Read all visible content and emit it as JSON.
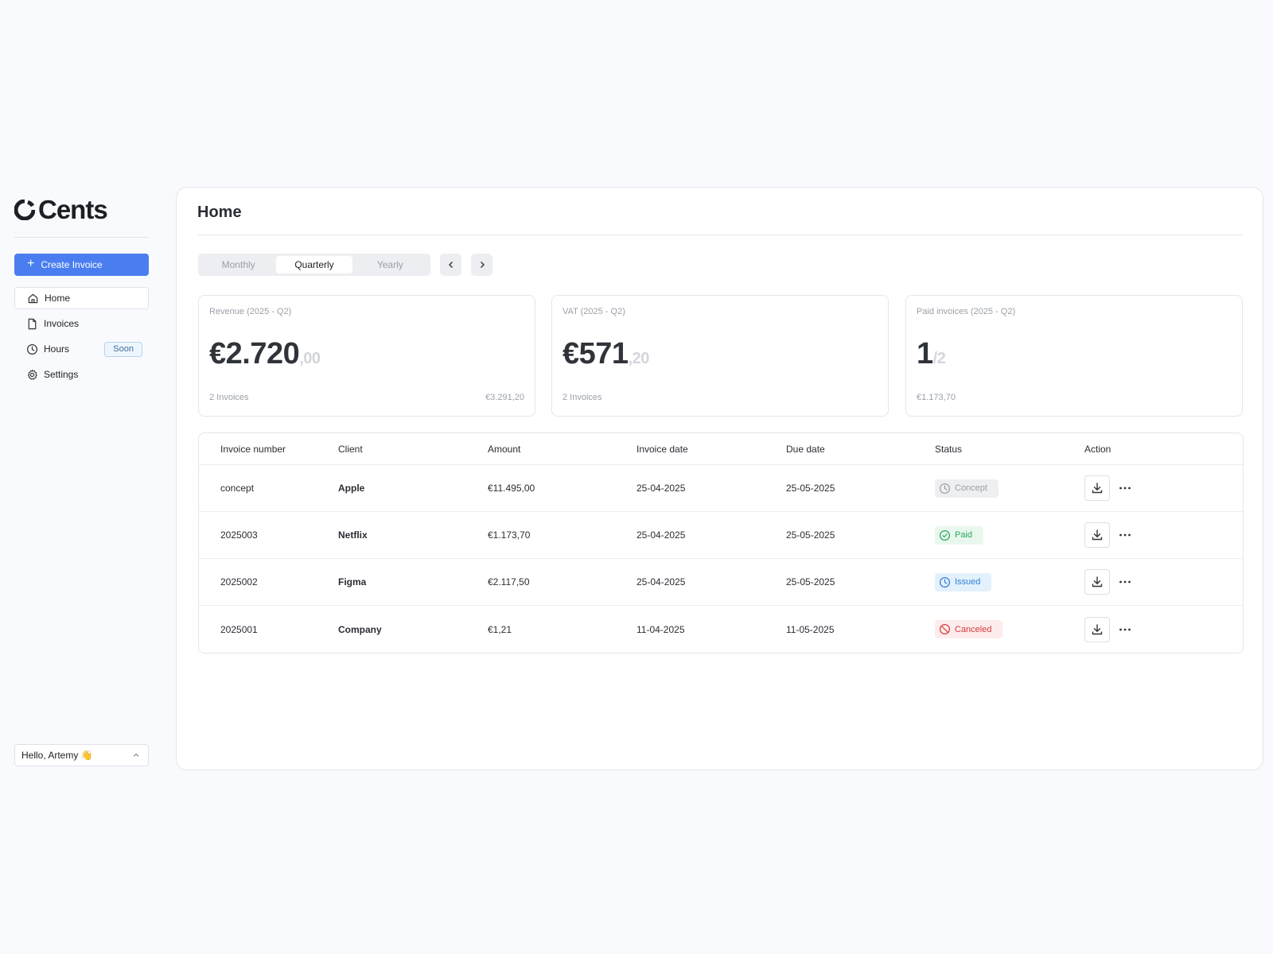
{
  "brand": {
    "name": "Cents"
  },
  "sidebar": {
    "create_label": "Create Invoice",
    "items": [
      {
        "label": "Home",
        "icon": "home-icon"
      },
      {
        "label": "Invoices",
        "icon": "file-icon"
      },
      {
        "label": "Hours",
        "icon": "clock-icon",
        "badge": "Soon"
      },
      {
        "label": "Settings",
        "icon": "gear-icon"
      }
    ],
    "user_greeting": "Hello, Artemy 👋"
  },
  "main": {
    "title": "Home",
    "period_tabs": [
      "Monthly",
      "Quarterly",
      "Yearly"
    ],
    "active_period": "Quarterly",
    "cards": [
      {
        "label": "Revenue (2025 - Q2)",
        "value": "€2.720",
        "decimals": ",00",
        "foot_left": "2 Invoices",
        "foot_right": "€3.291,20"
      },
      {
        "label": "VAT (2025 - Q2)",
        "value": "€571",
        "decimals": ",20",
        "foot_left": "2 Invoices",
        "foot_right": ""
      },
      {
        "label": "Paid invoices (2025 - Q2)",
        "value": "1",
        "decimals": "/2",
        "foot_left": "€1.173,70",
        "foot_right": ""
      }
    ],
    "table": {
      "headers": [
        "Invoice number",
        "Client",
        "Amount",
        "Invoice date",
        "Due date",
        "Status",
        "Action"
      ],
      "rows": [
        {
          "number": "concept",
          "client": "Apple",
          "amount": "€11.495,00",
          "invoice_date": "25-04-2025",
          "due_date": "25-05-2025",
          "status": "Concept"
        },
        {
          "number": "2025003",
          "client": "Netflix",
          "amount": "€1.173,70",
          "invoice_date": "25-04-2025",
          "due_date": "25-05-2025",
          "status": "Paid"
        },
        {
          "number": "2025002",
          "client": "Figma",
          "amount": "€2.117,50",
          "invoice_date": "25-04-2025",
          "due_date": "25-05-2025",
          "status": "Issued"
        },
        {
          "number": "2025001",
          "client": "Company",
          "amount": "€1,21",
          "invoice_date": "11-04-2025",
          "due_date": "11-05-2025",
          "status": "Canceled"
        }
      ]
    }
  },
  "colors": {
    "accent": "#4a7ef0",
    "paid": "#2aa55a",
    "issued": "#2d7ed6",
    "canceled": "#d63a3a",
    "concept": "#9aa0a8"
  }
}
